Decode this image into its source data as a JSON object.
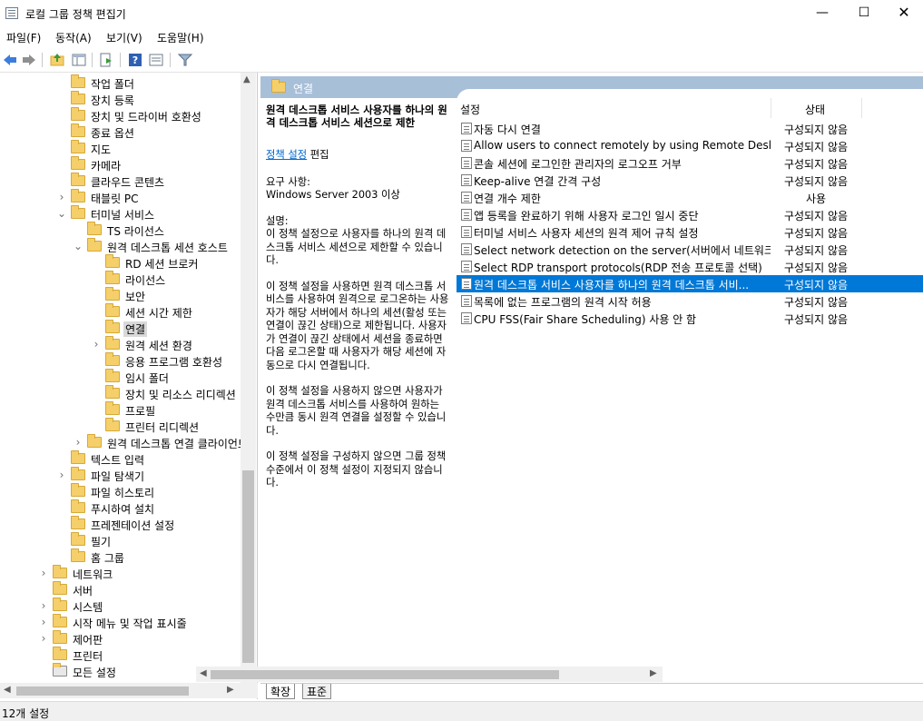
{
  "window": {
    "title": "로컬 그룹 정책 편집기",
    "minimize": "—",
    "maximize": "☐",
    "close": "✕"
  },
  "menu": [
    "파일(F)",
    "동작(A)",
    "보기(V)",
    "도움말(H)"
  ],
  "toolbar": {
    "buttons": [
      "back-icon",
      "forward-icon",
      "up-folder-icon",
      "show-hide-tree-icon",
      "export-list-icon",
      "help-icon",
      "properties-icon",
      "filter-icon"
    ]
  },
  "tree": [
    {
      "label": "작업 폴더",
      "level": 3,
      "arrow": ""
    },
    {
      "label": "장치 등록",
      "level": 3,
      "arrow": ""
    },
    {
      "label": "장치 및 드라이버 호환성",
      "level": 3,
      "arrow": ""
    },
    {
      "label": "종료 옵션",
      "level": 3,
      "arrow": ""
    },
    {
      "label": "지도",
      "level": 3,
      "arrow": ""
    },
    {
      "label": "카메라",
      "level": 3,
      "arrow": ""
    },
    {
      "label": "클라우드 콘텐츠",
      "level": 3,
      "arrow": ""
    },
    {
      "label": "태블릿 PC",
      "level": 3,
      "arrow": "›"
    },
    {
      "label": "터미널 서비스",
      "level": 3,
      "arrow": "⌄"
    },
    {
      "label": "TS 라이선스",
      "level": 4,
      "arrow": ""
    },
    {
      "label": "원격 데스크톱 세션 호스트",
      "level": 4,
      "arrow": "⌄"
    },
    {
      "label": "RD 세션 브로커",
      "level": 5,
      "arrow": ""
    },
    {
      "label": "라이선스",
      "level": 5,
      "arrow": ""
    },
    {
      "label": "보안",
      "level": 5,
      "arrow": ""
    },
    {
      "label": "세션 시간 제한",
      "level": 5,
      "arrow": ""
    },
    {
      "label": "연결",
      "level": 5,
      "arrow": "",
      "selected": true
    },
    {
      "label": "원격 세션 환경",
      "level": 5,
      "arrow": "›"
    },
    {
      "label": "응용 프로그램 호환성",
      "level": 5,
      "arrow": ""
    },
    {
      "label": "임시 폴더",
      "level": 5,
      "arrow": ""
    },
    {
      "label": "장치 및 리소스 리디렉션",
      "level": 5,
      "arrow": ""
    },
    {
      "label": "프로필",
      "level": 5,
      "arrow": ""
    },
    {
      "label": "프린터 리디렉션",
      "level": 5,
      "arrow": ""
    },
    {
      "label": "원격 데스크톱 연결 클라이언트",
      "level": 4,
      "arrow": "›"
    },
    {
      "label": "텍스트 입력",
      "level": 3,
      "arrow": ""
    },
    {
      "label": "파일 탐색기",
      "level": 3,
      "arrow": "›"
    },
    {
      "label": "파일 히스토리",
      "level": 3,
      "arrow": ""
    },
    {
      "label": "푸시하여 설치",
      "level": 3,
      "arrow": ""
    },
    {
      "label": "프레젠테이션 설정",
      "level": 3,
      "arrow": ""
    },
    {
      "label": "필기",
      "level": 3,
      "arrow": ""
    },
    {
      "label": "홈 그룹",
      "level": 3,
      "arrow": ""
    },
    {
      "label": "네트워크",
      "level": 2,
      "arrow": "›"
    },
    {
      "label": "서버",
      "level": 2,
      "arrow": ""
    },
    {
      "label": "시스템",
      "level": 2,
      "arrow": "›"
    },
    {
      "label": "시작 메뉴 및 작업 표시줄",
      "level": 2,
      "arrow": "›"
    },
    {
      "label": "제어판",
      "level": 2,
      "arrow": "›"
    },
    {
      "label": "프린터",
      "level": 2,
      "arrow": ""
    },
    {
      "label": "모든 설정",
      "level": 2,
      "arrow": "",
      "icon": "all-settings-icon"
    }
  ],
  "right": {
    "header_title": "연결",
    "description": {
      "title": "원격 데스크톱 서비스 사용자를 하나의 원격 데스크톱 서비스 세션으로 제한",
      "edit_link": "정책 설정",
      "edit_suffix": " 편집",
      "requirement_label": "요구 사항:",
      "requirement_value": "Windows Server 2003 이상",
      "desc_label": "설명:",
      "para1": "이 정책 설정으로 사용자를 하나의 원격 데스크톱 서비스 세션으로 제한할 수 있습니다.",
      "para2": "이 정책 설정을 사용하면 원격 데스크톱 서비스를 사용하여 원격으로 로그온하는 사용자가 해당 서버에서 하나의 세션(활성 또는 연결이 끊긴 상태)으로 제한됩니다. 사용자가 연결이 끊긴 상태에서 세션을 종료하면 다음 로그온할 때 사용자가 해당 세션에 자동으로 다시 연결됩니다.",
      "para3": "이 정책 설정을 사용하지 않으면 사용자가 원격 데스크톱 서비스를 사용하여 원하는 수만큼 동시 원격 연결을 설정할 수 있습니다.",
      "para4": "이 정책 설정을 구성하지 않으면 그룹 정책 수준에서 이 정책 설정이 지정되지 않습니다."
    },
    "columns": {
      "setting": "설정",
      "state": "상태"
    },
    "policies": [
      {
        "name": "자동 다시 연결",
        "state": "구성되지 않음"
      },
      {
        "name": "Allow users to connect remotely by using Remote Desktop...",
        "state": "구성되지 않음"
      },
      {
        "name": "콘솔 세션에 로그인한 관리자의 로그오프 거부",
        "state": "구성되지 않음"
      },
      {
        "name": "Keep-alive 연결 간격 구성",
        "state": "구성되지 않음"
      },
      {
        "name": "연결 개수 제한",
        "state": "사용"
      },
      {
        "name": "앱 등록을 완료하기 위해 사용자 로그인 일시 중단",
        "state": "구성되지 않음"
      },
      {
        "name": "터미널 서비스 사용자 세션의 원격 제어 규칙 설정",
        "state": "구성되지 않음"
      },
      {
        "name": "Select network detection on the server(서버에서 네트워크 ...",
        "state": "구성되지 않음"
      },
      {
        "name": "Select RDP transport protocols(RDP 전송 프로토콜 선택)",
        "state": "구성되지 않음"
      },
      {
        "name": "원격 데스크톱 서비스 사용자를 하나의 원격 데스크톱 서비...",
        "state": "구성되지 않음",
        "selected": true
      },
      {
        "name": "목록에 없는 프로그램의 원격 시작 허용",
        "state": "구성되지 않음"
      },
      {
        "name": "CPU FSS(Fair Share Scheduling) 사용 안 함",
        "state": "구성되지 않음"
      }
    ]
  },
  "tabs": [
    "확장",
    "표준"
  ],
  "status": "12개 설정"
}
